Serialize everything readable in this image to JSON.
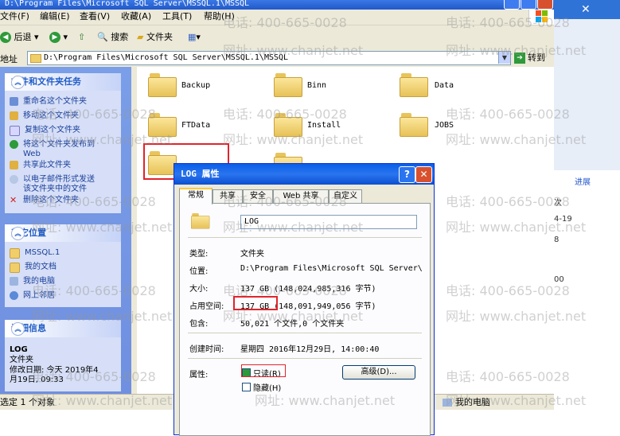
{
  "window_title": "D:\\Program Files\\Microsoft SQL Server\\MSSQL.1\\MSSQL",
  "menu": [
    "文件(F)",
    "编辑(E)",
    "查看(V)",
    "收藏(A)",
    "工具(T)",
    "帮助(H)"
  ],
  "toolbar": {
    "back": "后退",
    "search": "搜索",
    "folders": "文件夹"
  },
  "address": {
    "label": "地址",
    "value": "D:\\Program Files\\Microsoft SQL Server\\MSSQL.1\\MSSQL",
    "go": "转到"
  },
  "tasks": {
    "title": "文件和文件夹任务",
    "items": [
      "重命名这个文件夹",
      "移动这个文件夹",
      "复制这个文件夹",
      "将这个文件夹发布到",
      "Web",
      "共享此文件夹",
      "以电子邮件形式发送",
      "该文件夹中的文件",
      "删除这个文件夹"
    ]
  },
  "places": {
    "title": "其它位置",
    "items": [
      "MSSQL.1",
      "我的文档",
      "我的电脑",
      "网上邻居"
    ]
  },
  "details": {
    "title": "详细信息",
    "name": "LOG",
    "type": "文件夹",
    "modified_line1": "修改日期: 今天 2019年4",
    "modified_line2": "月19日, 09:33"
  },
  "folders": [
    "Backup",
    "Binn",
    "Data",
    "FTData",
    "Install",
    "JOBS"
  ],
  "status": {
    "left": "选定 1 个对象",
    "right": "我的电脑"
  },
  "dialog": {
    "title": "LOG 属性",
    "tabs": [
      "常规",
      "共享",
      "安全",
      "Web 共享",
      "自定义"
    ],
    "name": "LOG",
    "rows": [
      {
        "label": "类型:",
        "value": "文件夹"
      },
      {
        "label": "位置:",
        "value": "D:\\Program Files\\Microsoft SQL Server\\MSS"
      },
      {
        "label": "大小:",
        "value": "137 GB (148,024,985,316 字节)"
      },
      {
        "label": "占用空间:",
        "value": "137 GB (148,091,949,056 字节)"
      },
      {
        "label": "包含:",
        "value": "50,021 个文件,0 个文件夹"
      },
      {
        "label": "创建时间:",
        "value": "星期四 2016年12月29日, 14:00:40"
      }
    ],
    "attributes_label": "属性:",
    "readonly": "只读(R)",
    "hidden": "隐藏(H)",
    "advanced": "高级(D)..."
  },
  "right_window": {
    "link": "进展",
    "t1": "次",
    "t2": "4-19",
    "t3": "8",
    "t4": "00"
  },
  "watermark": {
    "phone": "电话: 400-665-0028",
    "site": "网址: www.chanjet.net"
  },
  "colors": {
    "accent": "#2158c8",
    "highlight": "#e0242c",
    "folder": "#f0cf6a"
  }
}
